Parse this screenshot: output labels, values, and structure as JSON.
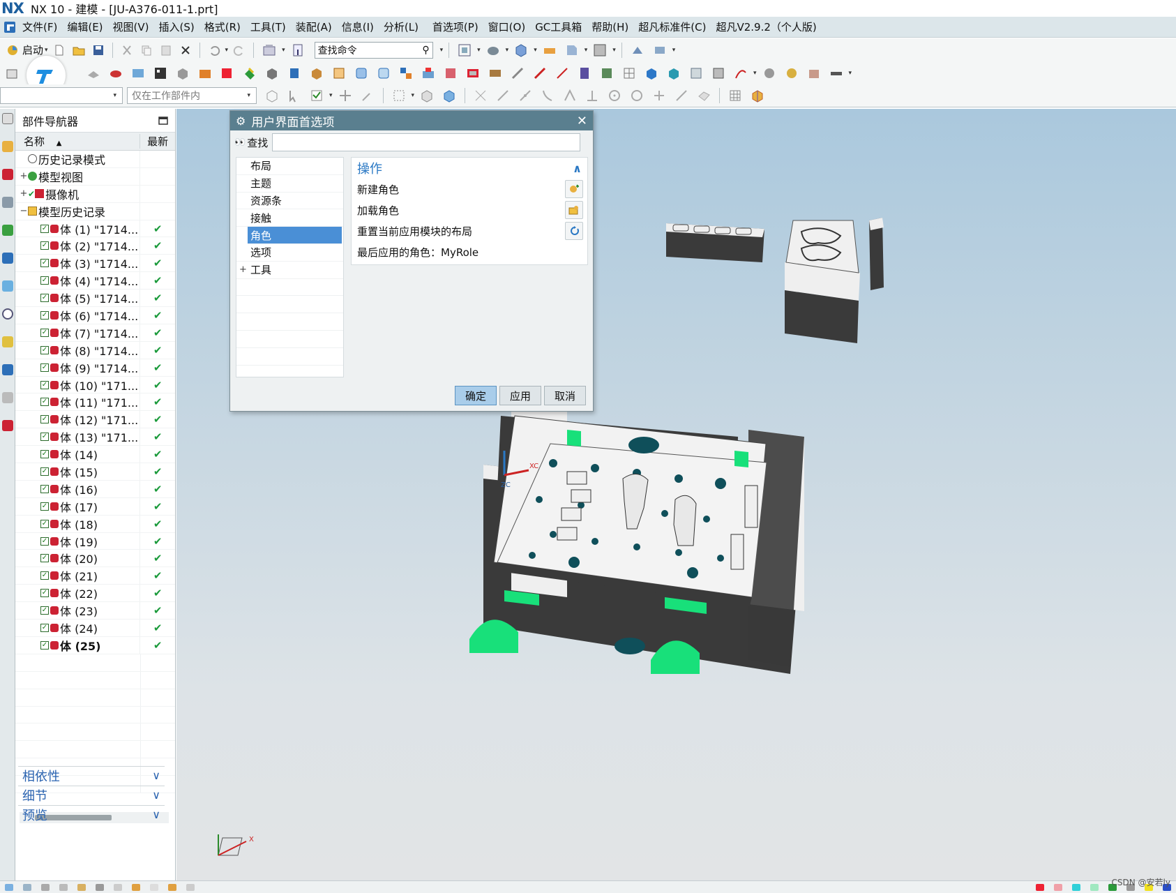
{
  "app": {
    "logo": "NX",
    "title": "NX 10 - 建模 - [JU-A376-011-1.prt]"
  },
  "menu": [
    "文件(F)",
    "编辑(E)",
    "视图(V)",
    "插入(S)",
    "格式(R)",
    "工具(T)",
    "装配(A)",
    "信息(I)",
    "分析(L)",
    "首选项(P)",
    "窗口(O)",
    "GC工具箱",
    "帮助(H)",
    "超凡标准件(C)",
    "超凡V2.9.2（个人版)"
  ],
  "toolbar": {
    "start_label": "启动",
    "search_command_placeholder": "查找命令",
    "selection_scope": "仅在工作部件内"
  },
  "navigator": {
    "title": "部件导航器",
    "col_name": "名称",
    "col_latest": "最新",
    "nodes": [
      {
        "label": "历史记录模式",
        "indent": 1,
        "expander": ""
      },
      {
        "label": "模型视图",
        "indent": 0,
        "expander": "+"
      },
      {
        "label": "摄像机",
        "indent": 0,
        "expander": "+"
      },
      {
        "label": "模型历史记录",
        "indent": 0,
        "expander": "−"
      }
    ],
    "bodies": [
      "体 (1) \"1714...",
      "体 (2) \"1714...",
      "体 (3) \"1714...",
      "体 (4) \"1714...",
      "体 (5) \"1714...",
      "体 (6) \"1714...",
      "体 (7) \"1714...",
      "体 (8) \"1714...",
      "体 (9) \"1714...",
      "体 (10) \"171...",
      "体 (11) \"171...",
      "体 (12) \"171...",
      "体 (13) \"171...",
      "体 (14)",
      "体 (15)",
      "体 (16)",
      "体 (17)",
      "体 (18)",
      "体 (19)",
      "体 (20)",
      "体 (21)",
      "体 (22)",
      "体 (23)",
      "体 (24)",
      "体 (25)"
    ],
    "latest_mark": "✔",
    "sections": [
      "相依性",
      "细节",
      "预览"
    ]
  },
  "dialog": {
    "title": "用户界面首选项",
    "search_label": "查找",
    "search_value": "",
    "categories": [
      "布局",
      "主题",
      "资源条",
      "接触",
      "角色",
      "选项",
      "工具"
    ],
    "selected_category": "角色",
    "ops_title": "操作",
    "ops": [
      "新建角色",
      "加载角色",
      "重置当前应用模块的布局"
    ],
    "last_role": "最后应用的角色：MyRole",
    "buttons": {
      "ok": "确定",
      "apply": "应用",
      "cancel": "取消"
    }
  },
  "viewport": {
    "triad_x": "XC",
    "triad_z": "ZC",
    "view_triad_x": "X"
  },
  "watermark": "CSDN @安若ly",
  "colors": {
    "menubar": "#dce6ea",
    "dialog_title": "#5a7f8f",
    "selection": "#4a8fd6",
    "latest_check": "#1a9a3a",
    "section_text": "#2a63b0",
    "model_face": "#f2f2f2",
    "model_side": "#3a3a3a",
    "model_accent": "#18e07a",
    "model_hole": "#0f4f5a"
  }
}
